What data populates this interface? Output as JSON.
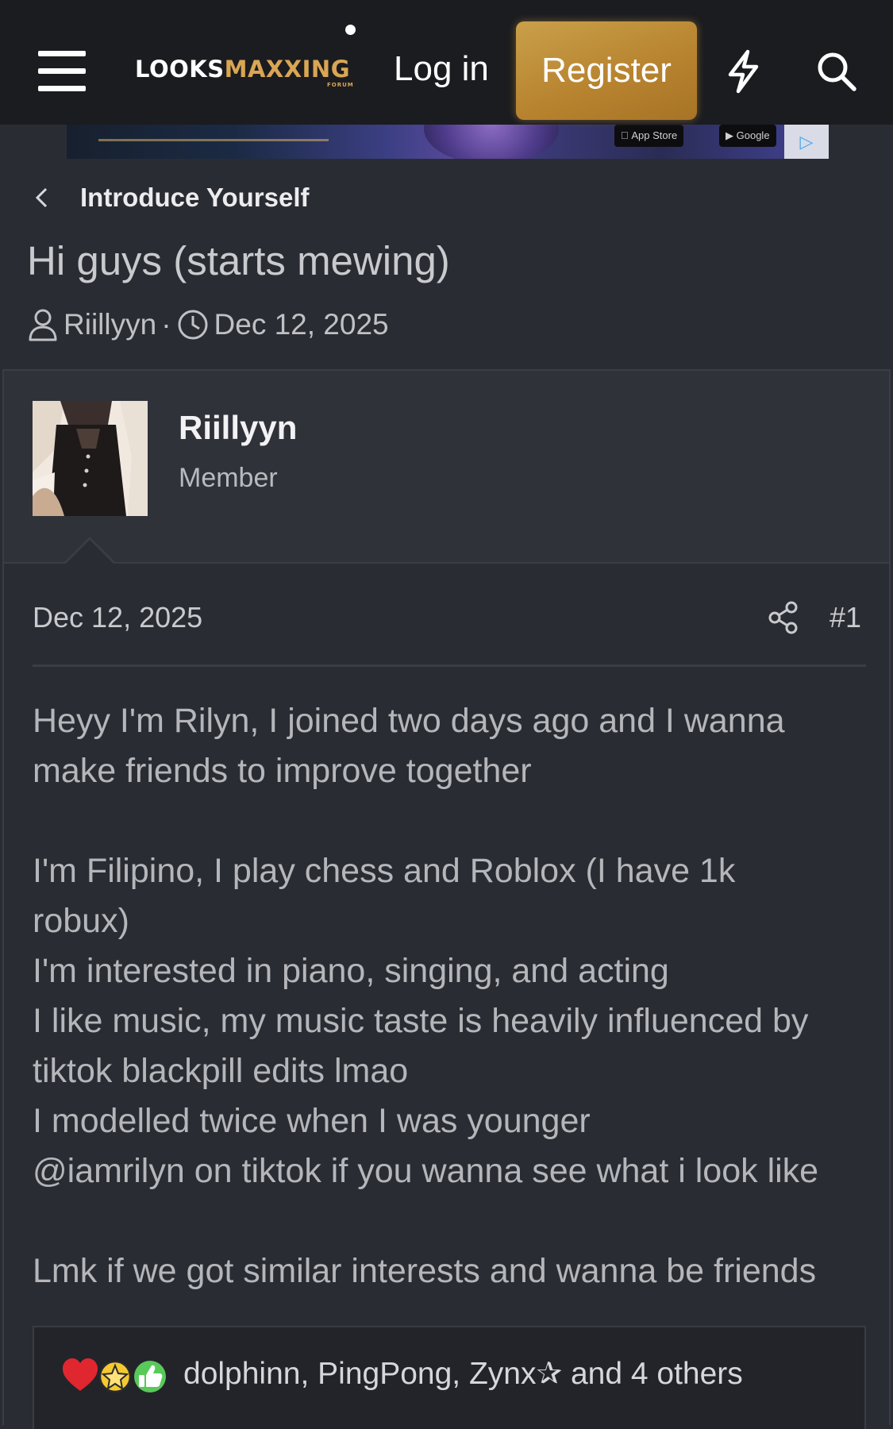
{
  "header": {
    "logo_main": "LOOKS",
    "logo_accent": "MAXXING",
    "logo_sub": "FORUM",
    "login_label": "Log in",
    "register_label": "Register",
    "icons": [
      "menu-icon",
      "bolt-icon",
      "search-icon"
    ],
    "accent_color": "#c49036"
  },
  "ad": {
    "app_store_label": "App Store",
    "google_label": "Google"
  },
  "breadcrumb": {
    "label": "Introduce Yourself"
  },
  "thread": {
    "title": "Hi guys (starts mewing)",
    "author": "Riillyyn",
    "separator": "·",
    "date": "Dec 12, 2025"
  },
  "post": {
    "username": "Riillyyn",
    "role": "Member",
    "date": "Dec 12, 2025",
    "number": "#1",
    "lines": [
      "Heyy I'm Rilyn, I joined two days ago and I wanna",
      "make friends to improve together",
      "",
      "I'm Filipino, I play chess and Roblox (I have 1k",
      "robux)",
      "I'm interested in piano, singing, and acting",
      "I like music, my music taste is heavily influenced by",
      "tiktok blackpill edits lmao",
      "I modelled twice when I was younger",
      "@iamrilyn on tiktok if you wanna see what i look like",
      "",
      "Lmk if we got similar interests and wanna be friends"
    ]
  },
  "reactions": {
    "summary": "dolphinn, PingPong, Zynx✰ and 4 others",
    "icons": [
      "heart-icon",
      "star-icon",
      "thumbs-up-icon"
    ]
  }
}
